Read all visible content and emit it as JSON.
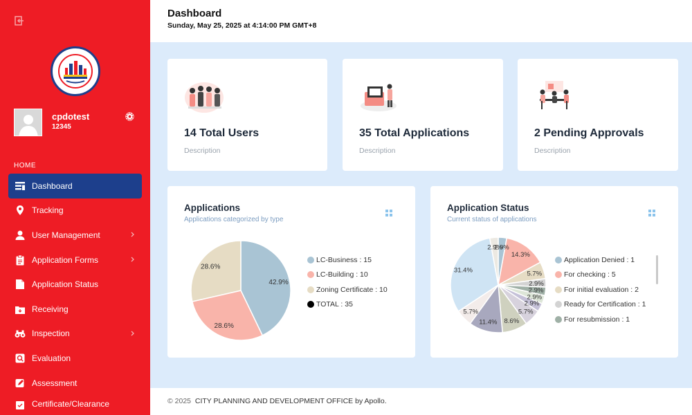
{
  "sidebar": {
    "user": {
      "name": "cpdotest",
      "id": "12345"
    },
    "section_label": "HOME",
    "items": [
      {
        "label": "Dashboard",
        "icon": "dashboard-icon",
        "active": true,
        "chevron": false
      },
      {
        "label": "Tracking",
        "icon": "location-pin-icon",
        "active": false,
        "chevron": false
      },
      {
        "label": "User Management",
        "icon": "user-icon",
        "active": false,
        "chevron": true
      },
      {
        "label": "Application Forms",
        "icon": "clipboard-icon",
        "active": false,
        "chevron": true
      },
      {
        "label": "Application Status",
        "icon": "document-icon",
        "active": false,
        "chevron": false
      },
      {
        "label": "Receiving",
        "icon": "inbox-icon",
        "active": false,
        "chevron": false
      },
      {
        "label": "Inspection",
        "icon": "binoculars-icon",
        "active": false,
        "chevron": true
      },
      {
        "label": "Evaluation",
        "icon": "search-icon",
        "active": false,
        "chevron": false
      },
      {
        "label": "Assessment",
        "icon": "pencil-icon",
        "active": false,
        "chevron": false
      },
      {
        "label": "Certificate/Clearance",
        "icon": "certificate-icon",
        "active": false,
        "chevron": false
      }
    ]
  },
  "header": {
    "title": "Dashboard",
    "datetime": "Sunday, May 25, 2025 at 4:14:00 PM GMT+8"
  },
  "stats": [
    {
      "title": "14 Total Users",
      "desc": "Description",
      "illustration": "team-illustration"
    },
    {
      "title": "35 Total Applications",
      "desc": "Description",
      "illustration": "applications-illustration"
    },
    {
      "title": "2 Pending Approvals",
      "desc": "Description",
      "illustration": "meeting-illustration"
    }
  ],
  "charts": {
    "applications": {
      "title": "Applications",
      "subtitle": "Applications categorized by type",
      "legend": [
        {
          "label": "LC-Business : 15",
          "color": "#a9c4d4"
        },
        {
          "label": "LC-Building : 10",
          "color": "#f9b4aa"
        },
        {
          "label": "Zoning Certificate : 10",
          "color": "#e6dcc4"
        },
        {
          "label": "TOTAL : 35",
          "color": "#000000"
        }
      ]
    },
    "status": {
      "title": "Application Status",
      "subtitle": "Current status of applications",
      "legend": [
        {
          "label": "Application Denied : 1",
          "color": "#a9c4d4"
        },
        {
          "label": "For checking : 5",
          "color": "#f9b4aa"
        },
        {
          "label": "For initial evaluation : 2",
          "color": "#e6dcc4"
        },
        {
          "label": "Ready for Certification : 1",
          "color": "#d3d3d3"
        },
        {
          "label": "For resubmission : 1",
          "color": "#9fb0a6"
        }
      ]
    }
  },
  "chart_data": [
    {
      "type": "pie",
      "title": "Applications",
      "categories": [
        "LC-Business",
        "LC-Building",
        "Zoning Certificate"
      ],
      "values": [
        15,
        10,
        10
      ],
      "labels": [
        "42.9%",
        "28.6%",
        "28.6%"
      ],
      "colors": [
        "#a9c4d4",
        "#f9b4aa",
        "#e6dcc4"
      ]
    },
    {
      "type": "pie",
      "title": "Application Status",
      "categories": [
        "Application Denied",
        "For checking",
        "For initial evaluation",
        "Ready for Certification",
        "For resubmission",
        "",
        "",
        "",
        "",
        "",
        "",
        "",
        ""
      ],
      "values": [
        1,
        5,
        2,
        1,
        1,
        1,
        1,
        2,
        3,
        4,
        2,
        11,
        1
      ],
      "labels": [
        "2.9%",
        "14.3%",
        "5.7%",
        "2.9%",
        "2.9%",
        "2.9%",
        "2.9%",
        "5.7%",
        "8.6%",
        "11.4%",
        "5.7%",
        "31.4%",
        "2.9%"
      ],
      "colors": [
        "#a9c4d4",
        "#f9b4aa",
        "#e6dcc4",
        "#d3d3d3",
        "#9fb0a6",
        "#dde6d8",
        "#c5c1d8",
        "#d7d2dd",
        "#cfd1bf",
        "#a8a8be",
        "#f3ecea",
        "#cfe4f4",
        "#ece9e2"
      ]
    }
  ],
  "footer": {
    "year": "© 2025",
    "text": "CITY PLANNING AND DEVELOPMENT OFFICE by Apollo."
  }
}
